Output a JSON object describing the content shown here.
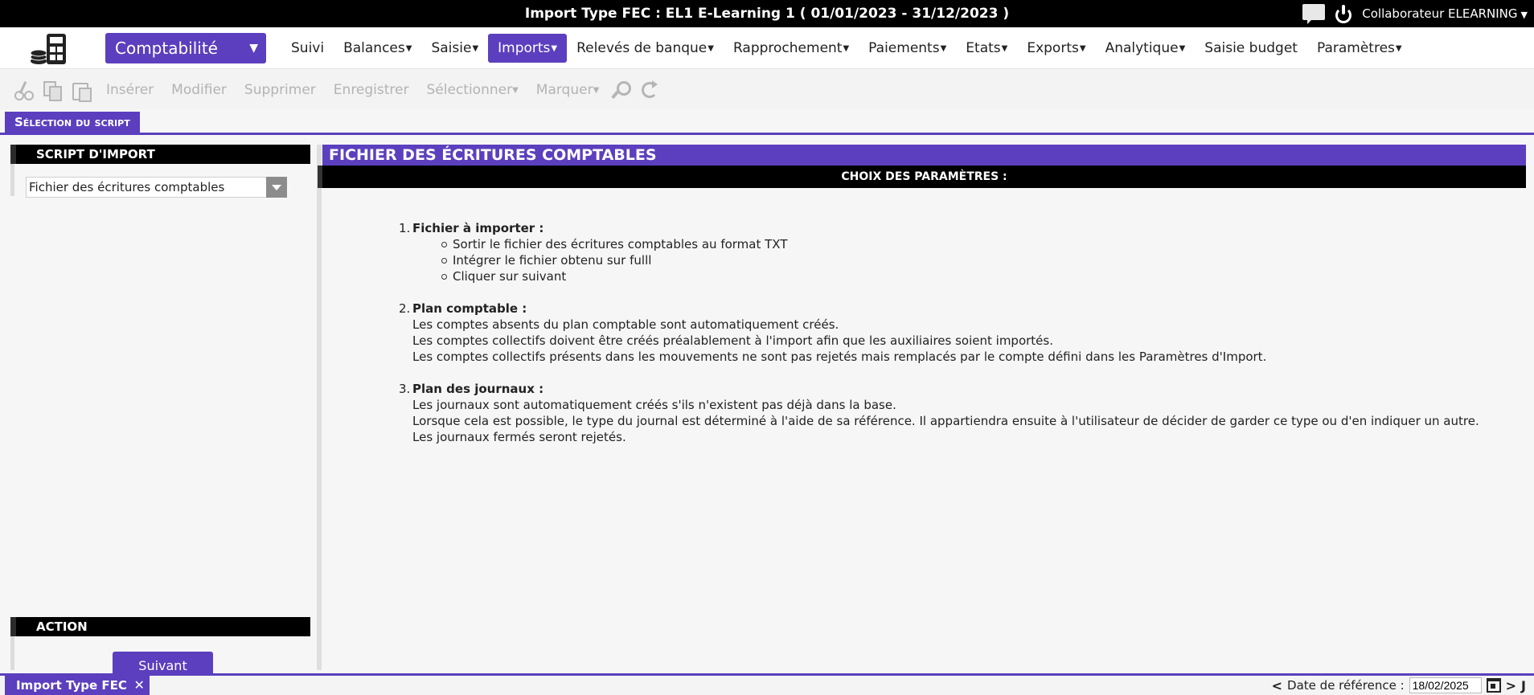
{
  "window": {
    "title": "Import Type FEC : EL1 E-Learning 1 ( 01/01/2023 - 31/12/2023 )",
    "user": "Collaborateur ELEARNING",
    "user_caret": "▼"
  },
  "menubar": {
    "module": "Comptabilité",
    "module_caret": "▼",
    "items": [
      {
        "label": "Suivi",
        "dd": ""
      },
      {
        "label": "Balances",
        "dd": "▼"
      },
      {
        "label": "Saisie",
        "dd": "▼"
      },
      {
        "label": "Imports",
        "dd": "▼"
      },
      {
        "label": "Relevés de banque",
        "dd": "▼"
      },
      {
        "label": "Rapprochement",
        "dd": "▼"
      },
      {
        "label": "Paiements",
        "dd": "▼"
      },
      {
        "label": "Etats",
        "dd": "▼"
      },
      {
        "label": "Exports",
        "dd": "▼"
      },
      {
        "label": "Analytique",
        "dd": "▼"
      },
      {
        "label": "Saisie budget",
        "dd": ""
      },
      {
        "label": "Paramètres",
        "dd": "▼"
      }
    ],
    "active": "Imports"
  },
  "toolbar": {
    "insert": "Insérer",
    "modify": "Modifier",
    "delete": "Supprimer",
    "save": "Enregistrer",
    "select": "Sélectionner",
    "mark": "Marquer",
    "dd": "▼"
  },
  "section_tab": "Sélection du script",
  "left_panel": {
    "script_header": "SCRIPT D'IMPORT",
    "script_value": "Fichier des écritures comptables",
    "action_header": "ACTION",
    "next_label": "Suivant"
  },
  "right_panel": {
    "title": "FICHIER DES ÉCRITURES COMPTABLES",
    "subtitle": "CHOIX DES PARAMÈTRES :",
    "sections": [
      {
        "num": "1.",
        "heading": "Fichier à importer :",
        "bullets": [
          "Sortir le fichier des écritures comptables au format TXT",
          "Intégrer le fichier obtenu sur fulll",
          "Cliquer sur suivant"
        ]
      },
      {
        "num": "2.",
        "heading": "Plan comptable :",
        "lines": [
          "Les comptes absents du plan comptable sont automatiquement créés.",
          "Les comptes collectifs doivent être créés préalablement à l'import afin que les auxiliaires soient importés.",
          "Les comptes collectifs présents dans les mouvements ne sont pas rejetés mais remplacés par le compte défini dans les Paramètres d'Import."
        ]
      },
      {
        "num": "3.",
        "heading": "Plan des journaux :",
        "lines": [
          "Les journaux sont automatiquement créés s'ils n'existent pas déjà dans la base.",
          "Lorsque cela est possible, le type du journal est déterminé à l'aide de sa référence. Il appartiendra ensuite à l'utilisateur de décider de garder ce type ou d'en indiquer un autre.",
          "Les journaux fermés seront rejetés."
        ]
      }
    ]
  },
  "statusbar": {
    "open_tab": "Import Type FEC",
    "close": "✕",
    "prev": "<",
    "date_label": "Date de référence :",
    "date_value": "18/02/2025",
    "next": ">",
    "today": "J"
  },
  "colors": {
    "accent": "#5b3fbe",
    "header": "#000000"
  }
}
